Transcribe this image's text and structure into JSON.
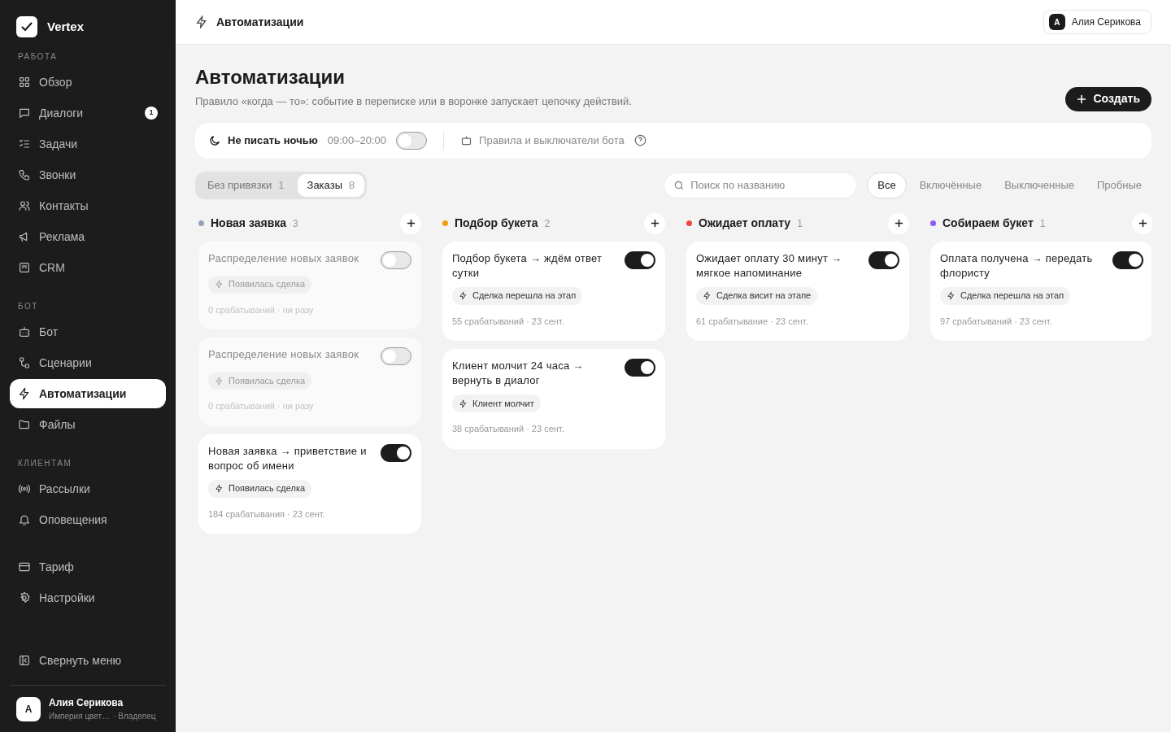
{
  "brand": {
    "name": "Vertex"
  },
  "sidebar": {
    "sections": [
      {
        "label": "РАБОТА",
        "items": [
          {
            "label": "Обзор",
            "selected": false
          },
          {
            "label": "Диалоги",
            "selected": false,
            "badge": "1"
          },
          {
            "label": "Задачи",
            "selected": false
          },
          {
            "label": "Звонки",
            "selected": false
          },
          {
            "label": "Контакты",
            "selected": false
          },
          {
            "label": "Реклама",
            "selected": false
          },
          {
            "label": "CRM",
            "selected": false
          }
        ]
      },
      {
        "label": "БОТ",
        "items": [
          {
            "label": "Бот",
            "selected": false
          },
          {
            "label": "Сценарии",
            "selected": false
          },
          {
            "label": "Автоматизации",
            "selected": true
          },
          {
            "label": "Файлы",
            "selected": false
          }
        ]
      },
      {
        "label": "КЛИЕНТАМ",
        "items": [
          {
            "label": "Рассылки",
            "selected": false
          },
          {
            "label": "Оповещения",
            "selected": false
          }
        ]
      },
      {
        "items": [
          {
            "label": "Тариф",
            "selected": false
          },
          {
            "label": "Настройки",
            "selected": false
          }
        ]
      }
    ],
    "collapse": "Свернуть меню",
    "user": {
      "initial": "А",
      "name": "Алия Серикова",
      "org": "Империя цвет…",
      "role": "· Владелец"
    }
  },
  "topbar": {
    "title": "Автоматизации",
    "user": {
      "initial": "А",
      "name": "Алия Серикова"
    }
  },
  "page": {
    "title": "Автоматизации",
    "subtitle": "Правило «когда — то»: событие в переписке или в воронке запускает цепочку действий.",
    "create_button": "Создать"
  },
  "settings": {
    "night_label": "Не писать ночью",
    "night_hours": "09:00–20:00",
    "night_on": false,
    "bot_rules": "Правила и выключатели бота"
  },
  "scope_tabs": [
    {
      "label": "Без привязки",
      "count": "1",
      "selected": false
    },
    {
      "label": "Заказы",
      "count": "8",
      "selected": true
    }
  ],
  "search": {
    "placeholder": "Поиск по названию"
  },
  "filters": [
    {
      "label": "Все",
      "selected": true
    },
    {
      "label": "Включённые",
      "selected": false
    },
    {
      "label": "Выключенные",
      "selected": false
    },
    {
      "label": "Пробные",
      "selected": false
    }
  ],
  "columns": [
    {
      "title": "Новая заявка",
      "count": "3",
      "color": "#94a3b8",
      "cards": [
        {
          "title": "Распределение новых заявок",
          "enabled": false,
          "trigger": "Появилась сделка",
          "stats": "0 срабатываний · ни разу"
        },
        {
          "title": "Распределение новых заявок",
          "enabled": false,
          "trigger": "Появилась сделка",
          "stats": "0 срабатываний · ни разу"
        },
        {
          "title": "Новая заявка → приветствие и вопрос об имени",
          "enabled": true,
          "trigger": "Появилась сделка",
          "stats": "184 срабатывания · 23 сент."
        }
      ]
    },
    {
      "title": "Подбор букета",
      "count": "2",
      "color": "#f59e0b",
      "cards": [
        {
          "title": "Подбор букета → ждём ответ сутки",
          "enabled": true,
          "trigger": "Сделка перешла на этап",
          "stats": "55 срабатываний · 23 сент."
        },
        {
          "title": "Клиент молчит 24 часа → вернуть в диалог",
          "enabled": true,
          "trigger": "Клиент молчит",
          "stats": "38 срабатываний · 23 сент."
        }
      ]
    },
    {
      "title": "Ожидает оплату",
      "count": "1",
      "color": "#ef4444",
      "cards": [
        {
          "title": "Ожидает оплату 30 минут → мягкое напоминание",
          "enabled": true,
          "trigger": "Сделка висит на этапе",
          "stats": "61 срабатывание · 23 сент."
        }
      ]
    },
    {
      "title": "Собираем букет",
      "count": "1",
      "color": "#8b5cf6",
      "cards": [
        {
          "title": "Оплата получена → передать флористу",
          "enabled": true,
          "trigger": "Сделка перешла на этап",
          "stats": "97 срабатываний · 23 сент."
        }
      ]
    }
  ]
}
